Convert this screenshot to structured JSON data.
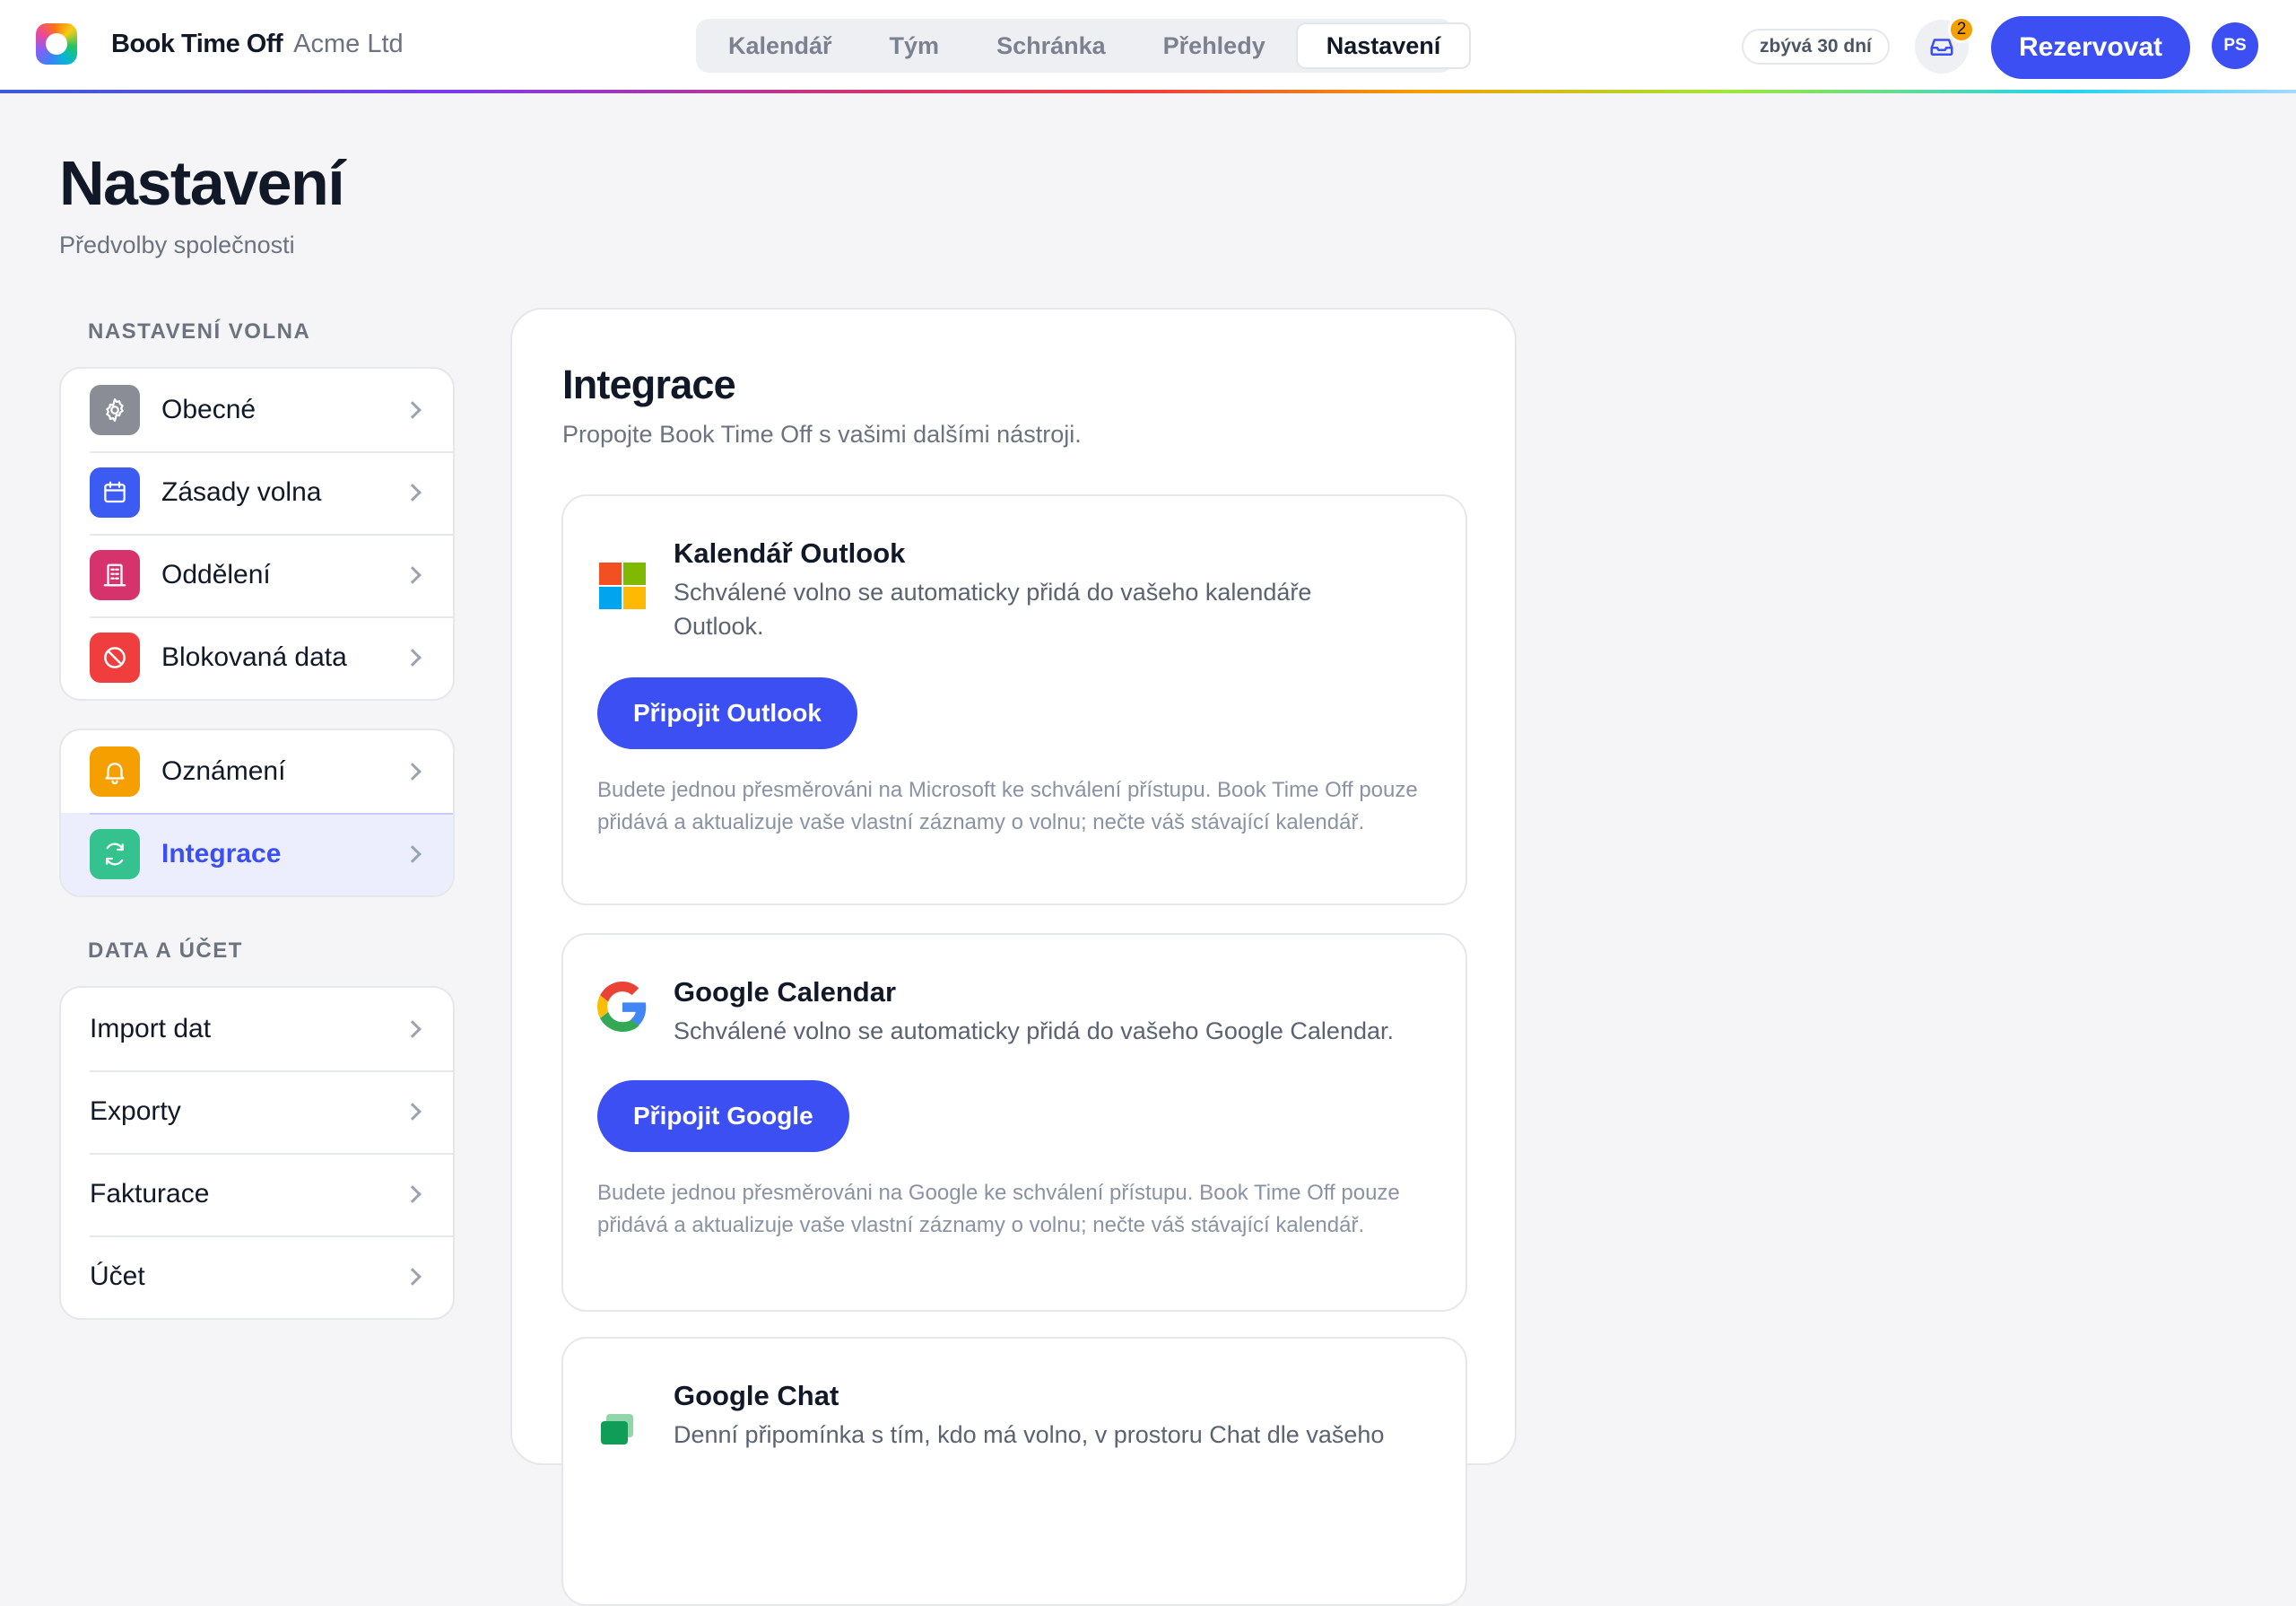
{
  "app": {
    "name": "Book Time Off",
    "company": "Acme Ltd"
  },
  "nav": {
    "tabs": [
      {
        "label": "Kalendář",
        "active": false
      },
      {
        "label": "Tým",
        "active": false
      },
      {
        "label": "Schránka",
        "active": false
      },
      {
        "label": "Přehledy",
        "active": false
      },
      {
        "label": "Nastavení",
        "active": true
      }
    ]
  },
  "header": {
    "trial_label": "zbývá 30 dní",
    "inbox_count": "2",
    "book_label": "Rezervovat",
    "avatar_initials": "PS"
  },
  "page": {
    "title": "Nastavení",
    "subtitle": "Předvolby společnosti"
  },
  "sidebar": {
    "section1_heading": "NASTAVENÍ VOLNA",
    "group1": [
      {
        "label": "Obecné",
        "icon": "gear-icon",
        "color": "#8a8d95"
      },
      {
        "label": "Zásady volna",
        "icon": "calendar-icon",
        "color": "#3b5bf2"
      },
      {
        "label": "Oddělení",
        "icon": "building-icon",
        "color": "#d6336c"
      },
      {
        "label": "Blokovaná data",
        "icon": "blocked-icon",
        "color": "#f03e3e"
      }
    ],
    "group2": [
      {
        "label": "Oznámení",
        "icon": "bell-icon",
        "color": "#f59f00"
      },
      {
        "label": "Integrace",
        "icon": "sync-icon",
        "color": "#34c38f",
        "active": true
      }
    ],
    "section2_heading": "DATA A ÚČET",
    "group3": [
      {
        "label": "Import dat"
      },
      {
        "label": "Exporty"
      },
      {
        "label": "Fakturace"
      },
      {
        "label": "Účet"
      }
    ]
  },
  "integrations": {
    "title": "Integrace",
    "subtitle": "Propojte Book Time Off s vašimi dalšími nástroji.",
    "items": [
      {
        "name": "Kalendář Outlook",
        "description": "Schválené volno se automaticky přidá do vašeho kalendáře Outlook.",
        "button": "Připojit Outlook",
        "note": "Budete jednou přesměrováni na Microsoft ke schválení přístupu. Book Time Off pouze přidává a aktualizuje vaše vlastní záznamy o volnu; nečte váš stávající kalendář.",
        "icon": "microsoft-icon"
      },
      {
        "name": "Google Calendar",
        "description": "Schválené volno se automaticky přidá do vašeho Google Calendar.",
        "button": "Připojit Google",
        "note": "Budete jednou přesměrováni na Google ke schválení přístupu. Book Time Off pouze přidává a aktualizuje vaše vlastní záznamy o volnu; nečte váš stávající kalendář.",
        "icon": "google-icon"
      },
      {
        "name": "Google Chat",
        "description": "Denní připomínka s tím, kdo má volno, v prostoru Chat dle vašeho",
        "icon": "google-chat-icon"
      }
    ]
  },
  "colors": {
    "accent": "#3b4ff2",
    "badge": "#f59f00"
  }
}
